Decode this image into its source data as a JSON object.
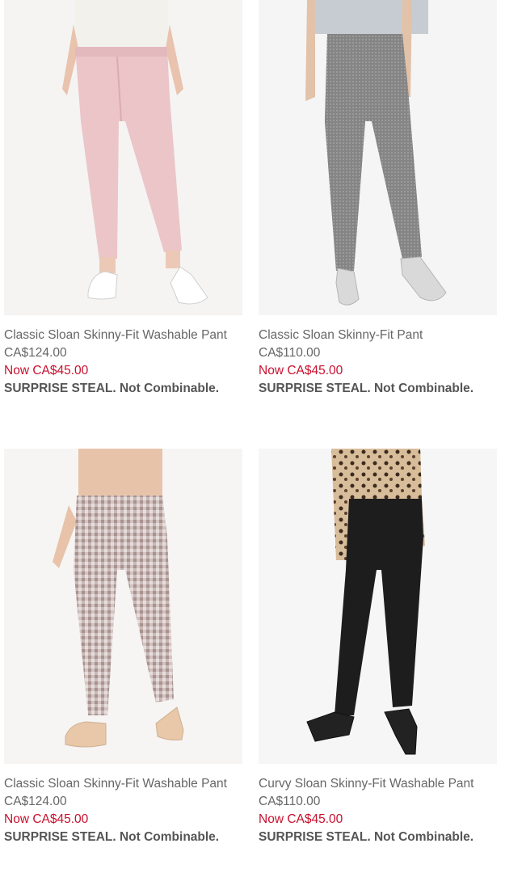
{
  "products": [
    {
      "name": "Classic Sloan Skinny-Fit Washable Pant",
      "original_price": "CA$124.00",
      "sale_price": "Now CA$45.00",
      "promo": "SURPRISE STEAL. Not Combinable.",
      "image": "pink-pants-white-flats"
    },
    {
      "name": "Classic Sloan Skinny-Fit Pant",
      "original_price": "CA$110.00",
      "sale_price": "Now CA$45.00",
      "promo": "SURPRISE STEAL. Not Combinable.",
      "image": "grey-pants-silver-heels"
    },
    {
      "name": "Classic Sloan Skinny-Fit Washable Pant",
      "original_price": "CA$124.00",
      "sale_price": "Now CA$45.00",
      "promo": "SURPRISE STEAL. Not Combinable.",
      "image": "gingham-pants-beige-flats"
    },
    {
      "name": "Curvy Sloan Skinny-Fit Washable Pant",
      "original_price": "CA$110.00",
      "sale_price": "Now CA$45.00",
      "promo": "SURPRISE STEAL. Not Combinable.",
      "image": "black-pants-black-heels"
    }
  ],
  "colors": {
    "sale": "#c8102e",
    "text": "#666666",
    "promo": "#555555"
  }
}
